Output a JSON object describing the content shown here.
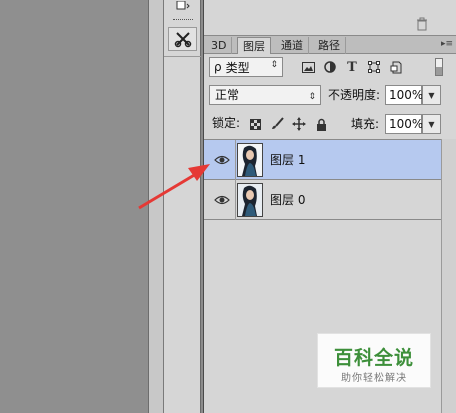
{
  "tabs": [
    {
      "label": "3D"
    },
    {
      "label": "图层",
      "active": true
    },
    {
      "label": "通道"
    },
    {
      "label": "路径"
    }
  ],
  "filter": {
    "search_icon": "ρ",
    "kind_label": "类型"
  },
  "blend_mode": {
    "value": "正常"
  },
  "opacity": {
    "label": "不透明度:",
    "value": "100%"
  },
  "lock": {
    "label": "锁定:"
  },
  "fill": {
    "label": "填充:",
    "value": "100%"
  },
  "layers": [
    {
      "name": "图层 1",
      "selected": true,
      "visible": true
    },
    {
      "name": "图层 0",
      "selected": false,
      "visible": true
    }
  ],
  "watermark": {
    "title": "百科全说",
    "subtitle": "助你轻松解决"
  },
  "colors": {
    "selected_row": "#b6c9ef",
    "annotation_arrow": "#e53935",
    "watermark_green": "#3d8f3a"
  }
}
